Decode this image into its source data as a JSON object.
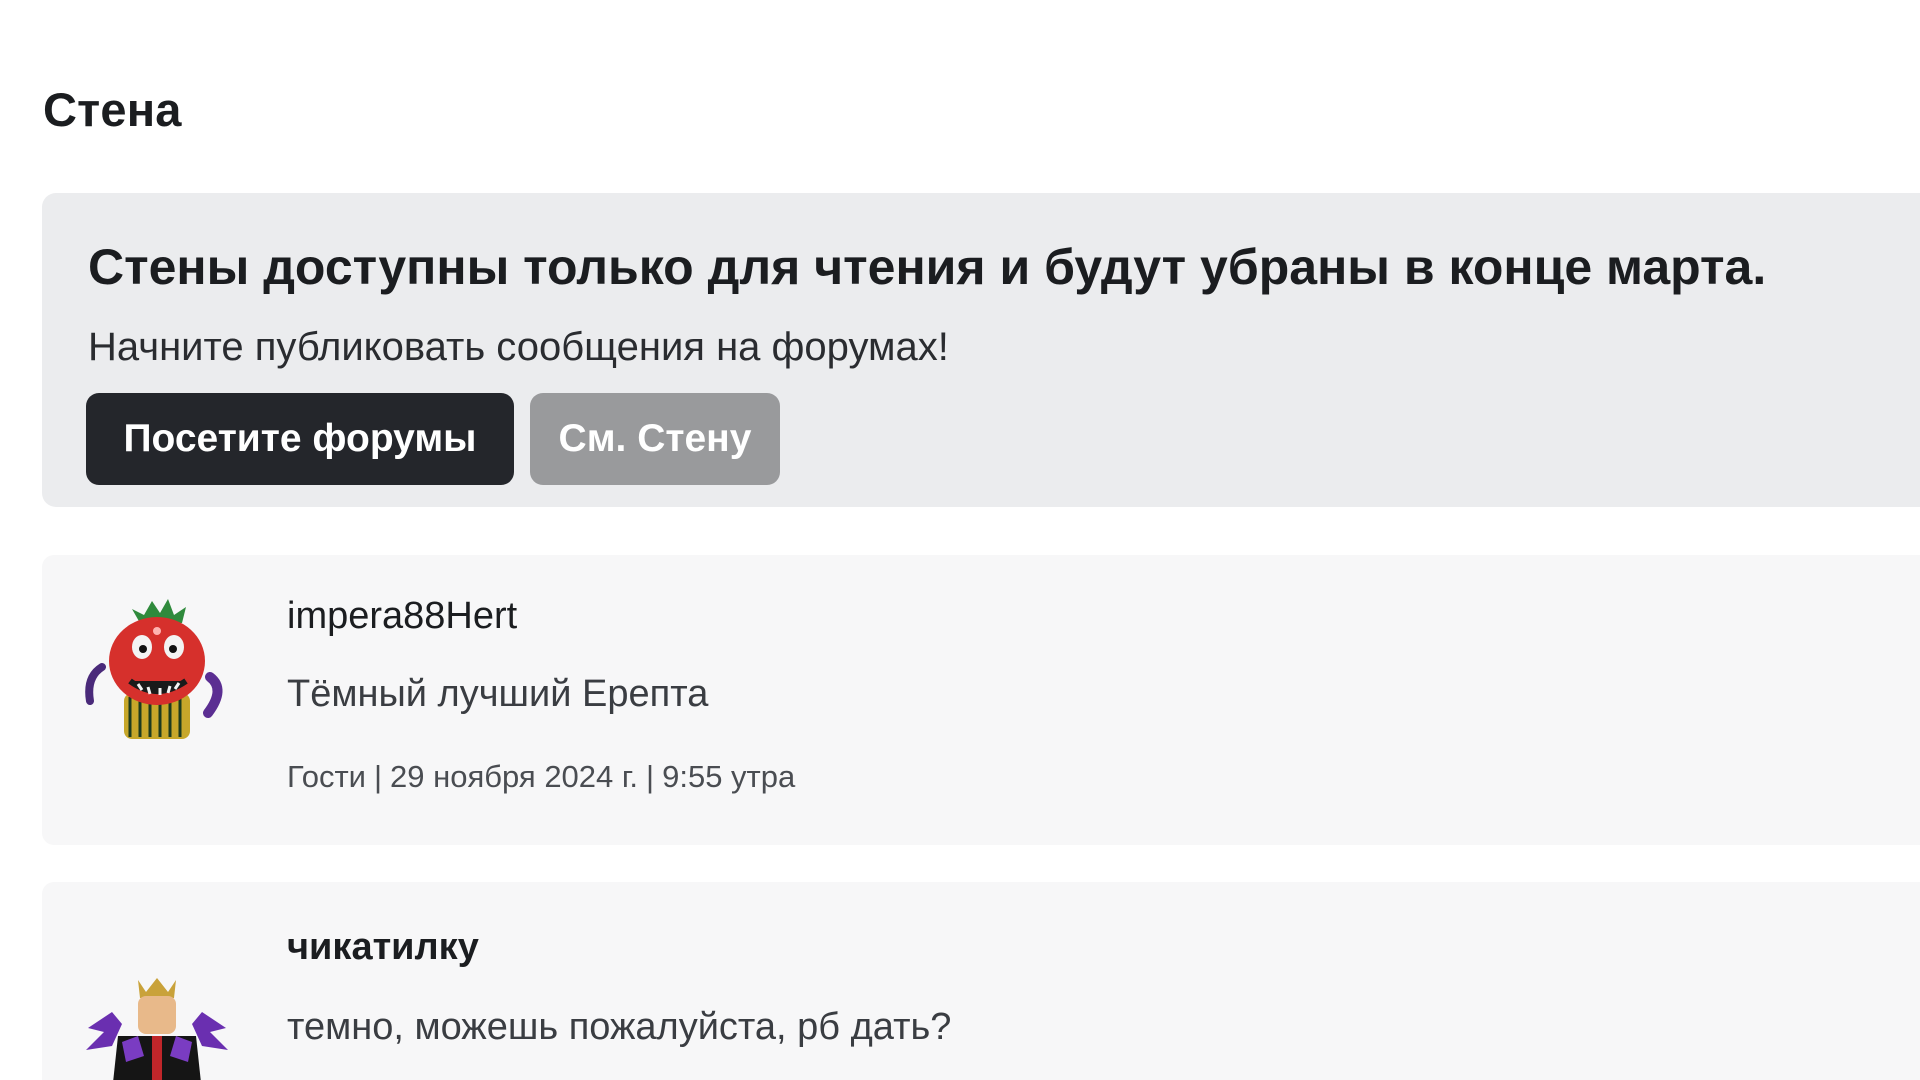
{
  "wall": {
    "title": "Стена"
  },
  "notice": {
    "heading": "Стены доступны только для чтения и будут убраны в конце марта.",
    "subtext": "Начните публиковать сообщения на форумах!",
    "primary_button": "Посетите форумы",
    "secondary_button": "См. Стену"
  },
  "posts": [
    {
      "author": "impera88Hert",
      "message": "Тёмный лучший Ерепта",
      "group": "Гости",
      "date": "29 ноября 2024 г.",
      "time": "9:55 утра",
      "avatar_icon": "strawberry-character-avatar-icon"
    },
    {
      "author": "чикатилку",
      "message": "темно, можешь пожалуйста, рб дать?",
      "avatar_icon": "purple-winged-character-avatar-icon"
    }
  ],
  "colors": {
    "notice_bg": "#ebecee",
    "primary_button_bg": "#24262b",
    "secondary_button_bg": "#999a9c",
    "post_bg": "#f7f7f8"
  }
}
